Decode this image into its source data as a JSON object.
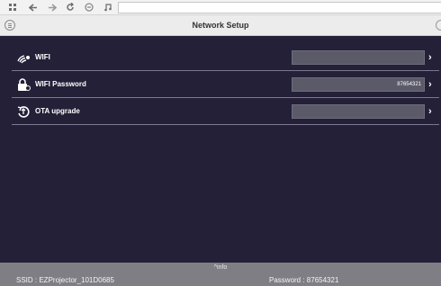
{
  "app": {
    "title": "Network Setup"
  },
  "settings": {
    "items": [
      {
        "label": "WIFI",
        "value": "",
        "icon": "wifi-signal-icon"
      },
      {
        "label": "WIFI Password",
        "value": "87654321",
        "icon": "lock-icon"
      },
      {
        "label": "OTA upgrade",
        "value": "",
        "icon": "upgrade-icon"
      }
    ]
  },
  "footer": {
    "toggle_label": "info",
    "ssid": "SSID : EZProjector_101D0685",
    "password": "Password : 87654321"
  }
}
